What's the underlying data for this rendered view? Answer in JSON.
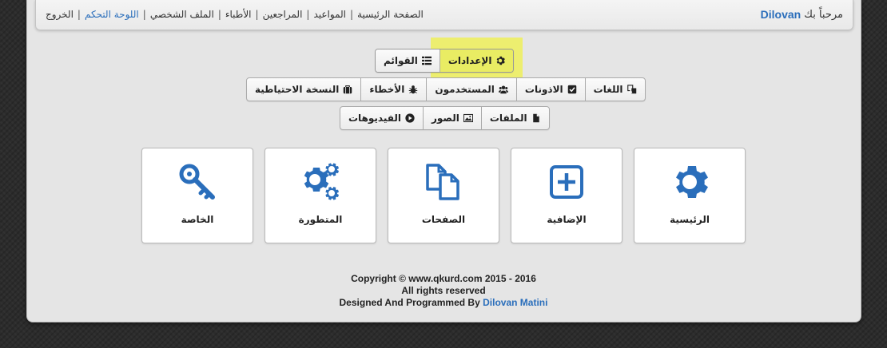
{
  "header": {
    "welcome_text": "مرحباً بك",
    "username": "Dilovan",
    "nav": [
      {
        "label": "الصفحة الرئيسية",
        "active": false
      },
      {
        "label": "المواعيد",
        "active": false
      },
      {
        "label": "المراجعين",
        "active": false
      },
      {
        "label": "الأطباء",
        "active": false
      },
      {
        "label": "الملف الشخصي",
        "active": false
      },
      {
        "label": "اللوحة التحكم",
        "active": true
      },
      {
        "label": "الخروج",
        "active": false
      }
    ]
  },
  "tabs": {
    "settings": "الإعدادات",
    "lists": "القوائم"
  },
  "row1": {
    "languages": "اللغات",
    "permissions": "الاذونات",
    "users": "المستخدمون",
    "errors": "الأخطاء",
    "backup": "النسخة الاحتياطية"
  },
  "row2": {
    "files": "الملفات",
    "images": "الصور",
    "videos": "الفيديوهات"
  },
  "tiles": {
    "main": "الرئيسية",
    "additional": "الإضافية",
    "pages": "الصفحات",
    "advanced": "المتطورة",
    "private": "الخاصة"
  },
  "footer": {
    "copyright": "Copyright © www.qkurd.com 2015 - 2016",
    "rights": "All rights reserved",
    "designed_by": "Designed And Programmed By",
    "author": "Dilovan Matini"
  },
  "colors": {
    "accent": "#2a6ebb",
    "highlight": "#eef05a"
  }
}
